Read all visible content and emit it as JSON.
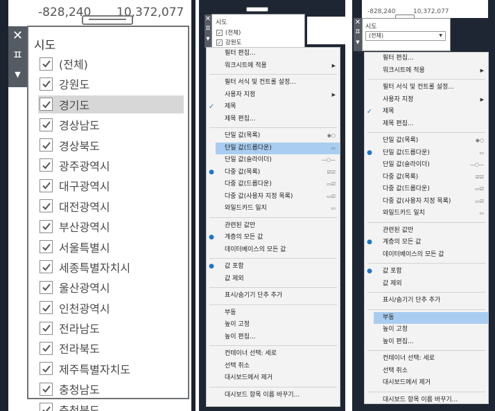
{
  "panel_a": {
    "range_low": "-828,240",
    "range_high": "10,372,077",
    "title": "시도",
    "items": [
      {
        "label": "(전체)"
      },
      {
        "label": "강원도"
      },
      {
        "label": "경기도"
      },
      {
        "label": "경상남도"
      },
      {
        "label": "경상북도"
      },
      {
        "label": "광주광역시"
      },
      {
        "label": "대구광역시"
      },
      {
        "label": "대전광역시"
      },
      {
        "label": "부산광역시"
      },
      {
        "label": "서울특별시"
      },
      {
        "label": "세종특별자치시"
      },
      {
        "label": "울산광역시"
      },
      {
        "label": "인천광역시"
      },
      {
        "label": "전라남도"
      },
      {
        "label": "전라북도"
      },
      {
        "label": "제주특별자치도"
      },
      {
        "label": "충청남도"
      },
      {
        "label": "충청북도"
      }
    ],
    "highlighted_item": "경기도"
  },
  "panel_b": {
    "title": "시도",
    "mini_items": [
      "(전체)",
      "강원도"
    ],
    "menu": [
      {
        "label": "필터 편집..."
      },
      {
        "label": "워크시트에 적용",
        "submenu": true
      },
      {
        "sep": true
      },
      {
        "label": "필터 서식 및 컨트롤 설정..."
      },
      {
        "label": "사용자 지정",
        "submenu": true
      },
      {
        "label": "제목",
        "checked": true
      },
      {
        "label": "제목 편집..."
      },
      {
        "sep": true
      },
      {
        "label": "단일 값(목록)",
        "icon": "radio-icon"
      },
      {
        "label": "단일 값(드롭다운)",
        "icon": "dropdown-icon",
        "highlight": true
      },
      {
        "label": "단일 값(슬라이더)",
        "icon": "slider-icon"
      },
      {
        "label": "다중 값(목록)",
        "icon": "checklist-icon",
        "bullet": true
      },
      {
        "label": "다중 값(드롭다운)",
        "icon": "dropdown-check-icon"
      },
      {
        "label": "다중 값(사용자 지정 목록)",
        "icon": "custom-list-icon"
      },
      {
        "label": "와일드카드 일치",
        "icon": "wildcard-icon"
      },
      {
        "sep": true
      },
      {
        "label": "관련된 값만"
      },
      {
        "label": "계층의 모든 값",
        "bullet": true
      },
      {
        "label": "데이터베이스의 모든 값"
      },
      {
        "sep": true
      },
      {
        "label": "값 포함",
        "bullet": true
      },
      {
        "label": "값 제외"
      },
      {
        "sep": true
      },
      {
        "label": "표시/숨기기 단추 추가"
      },
      {
        "sep": true
      },
      {
        "label": "부동"
      },
      {
        "label": "높이 고정"
      },
      {
        "label": "높이 편집..."
      },
      {
        "sep": true
      },
      {
        "label": "컨테이너 선택: 세로"
      },
      {
        "label": "선택 취소"
      },
      {
        "label": "대시보드에서 제거"
      },
      {
        "sep": true
      },
      {
        "label": "대시보드 항목 이름 바꾸기..."
      }
    ]
  },
  "panel_c": {
    "range_low": "-828,240",
    "range_high": "10,372,077",
    "title": "시도",
    "select_value": "(전체)",
    "menu": [
      {
        "label": "필터 편집..."
      },
      {
        "label": "워크시트에 적용",
        "submenu": true
      },
      {
        "sep": true
      },
      {
        "label": "필터 서식 및 컨트롤 설정..."
      },
      {
        "label": "사용자 지정",
        "submenu": true
      },
      {
        "label": "제목",
        "checked": true
      },
      {
        "label": "제목 편집..."
      },
      {
        "sep": true
      },
      {
        "label": "단일 값(목록)",
        "icon": "radio-icon"
      },
      {
        "label": "단일 값(드롭다운)",
        "icon": "dropdown-icon",
        "bullet": true
      },
      {
        "label": "단일 값(슬라이더)",
        "icon": "slider-icon"
      },
      {
        "label": "다중 값(목록)",
        "icon": "checklist-icon"
      },
      {
        "label": "다중 값(드롭다운)",
        "icon": "dropdown-check-icon"
      },
      {
        "label": "다중 값(사용자 지정 목록)",
        "icon": "custom-list-icon"
      },
      {
        "label": "와일드카드 일치",
        "icon": "wildcard-icon"
      },
      {
        "sep": true
      },
      {
        "label": "관련된 값만"
      },
      {
        "label": "계층의 모든 값",
        "bullet": true
      },
      {
        "label": "데이터베이스의 모든 값"
      },
      {
        "sep": true
      },
      {
        "label": "값 포함",
        "bullet": true
      },
      {
        "label": "값 제외"
      },
      {
        "sep": true
      },
      {
        "label": "표시/숨기기 단추 추가"
      },
      {
        "sep": true
      },
      {
        "label": "부동",
        "highlight": true
      },
      {
        "label": "높이 고정"
      },
      {
        "label": "높이 편집..."
      },
      {
        "sep": true
      },
      {
        "label": "컨테이너 선택: 세로"
      },
      {
        "label": "선택 취소"
      },
      {
        "label": "대시보드에서 제거"
      },
      {
        "sep": true
      },
      {
        "label": "대시보드 항목 이름 바꾸기..."
      }
    ]
  }
}
